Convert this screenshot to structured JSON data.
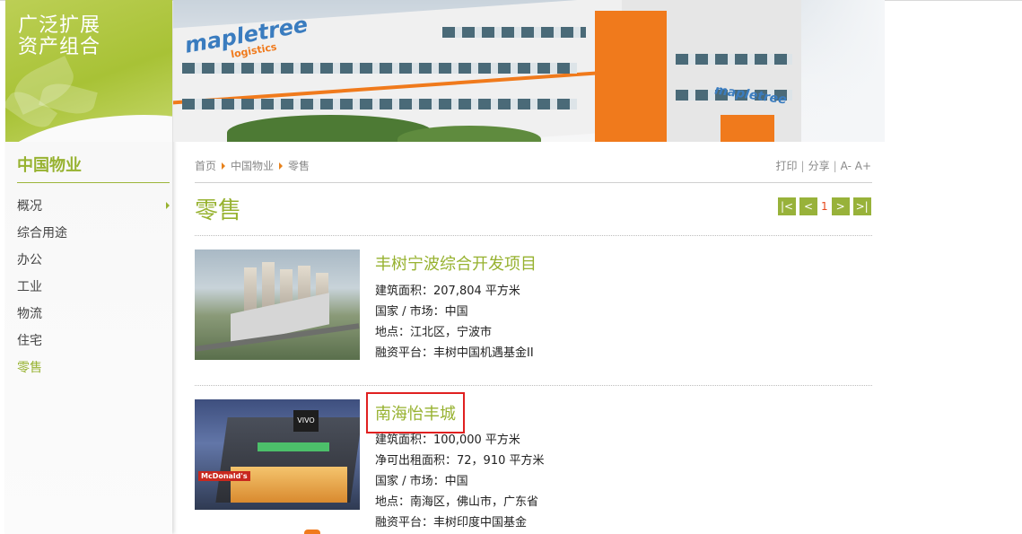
{
  "sidebar": {
    "banner_line1": "广泛扩展",
    "banner_line2": "资产组合",
    "title": "中国物业",
    "items": [
      {
        "label": "概况"
      },
      {
        "label": "综合用途"
      },
      {
        "label": "办公"
      },
      {
        "label": "工业"
      },
      {
        "label": "物流"
      },
      {
        "label": "住宅"
      },
      {
        "label": "零售"
      }
    ],
    "active_index": 6
  },
  "hero": {
    "logo_main": "mapletree",
    "logo_sub": "logistics",
    "logo_second": "mapletree"
  },
  "breadcrumb": {
    "items": [
      "首页",
      "中国物业",
      "零售"
    ]
  },
  "tools": {
    "print": "打印",
    "share": "分享",
    "font_smaller": "A-",
    "font_larger": "A+"
  },
  "page_title": "零售",
  "pager": {
    "first": "|<",
    "prev": "<",
    "current": "1",
    "next": ">",
    "last": ">|"
  },
  "listings": [
    {
      "title": "丰树宁波综合开发项目",
      "details": [
        "建筑面积：207,804 平方米",
        "国家 / 市场：中国",
        "地点：江北区，宁波市",
        "融资平台：丰树中国机遇基金II"
      ]
    },
    {
      "title": "南海怡丰城",
      "details": [
        "建筑面积：100,000 平方米",
        "净可出租面积：72，910 平方米",
        "国家 / 市场：中国",
        "地点：南海区，佛山市，广东省",
        "融资平台：丰树印度中国基金"
      ]
    }
  ],
  "colors": {
    "accent_green": "#97b230",
    "pager_green": "#98b23a",
    "breadcrumb_arrow": "#e7811b",
    "highlight_box": "#e02020"
  }
}
